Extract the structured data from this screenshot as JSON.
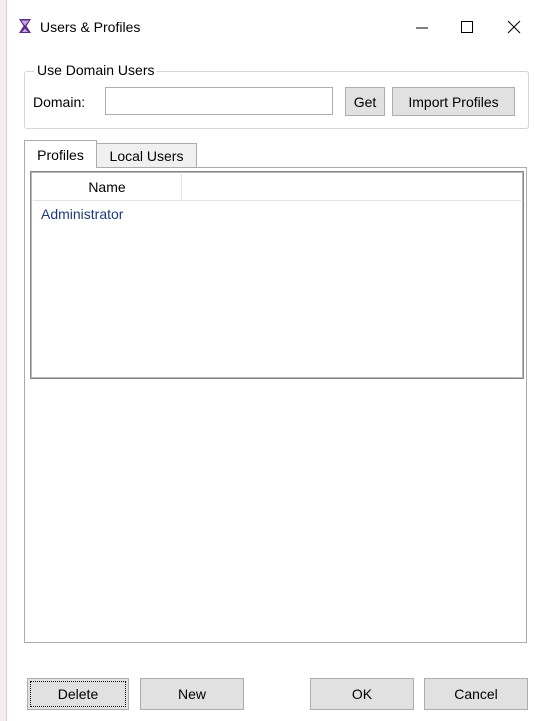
{
  "window": {
    "title": "Users & Profiles",
    "minimize_glyph": "—",
    "maximize_glyph": "☐",
    "close_glyph": "✕"
  },
  "domain_group": {
    "legend": "Use Domain Users",
    "domain_label": "Domain:",
    "domain_value": "",
    "get_label": "Get",
    "import_label": "Import Profiles"
  },
  "tabs": [
    {
      "label": "Profiles",
      "selected": true
    },
    {
      "label": "Local Users",
      "selected": false
    }
  ],
  "profiles_list": {
    "columns": [
      "Name"
    ],
    "rows": [
      {
        "name": "Administrator"
      }
    ]
  },
  "footer": {
    "delete_label": "Delete",
    "new_label": "New",
    "ok_label": "OK",
    "cancel_label": "Cancel"
  },
  "colors": {
    "row_text": "#1f3a7a",
    "button_bg": "#e1e1e1",
    "app_icon": "#5b2a86"
  }
}
